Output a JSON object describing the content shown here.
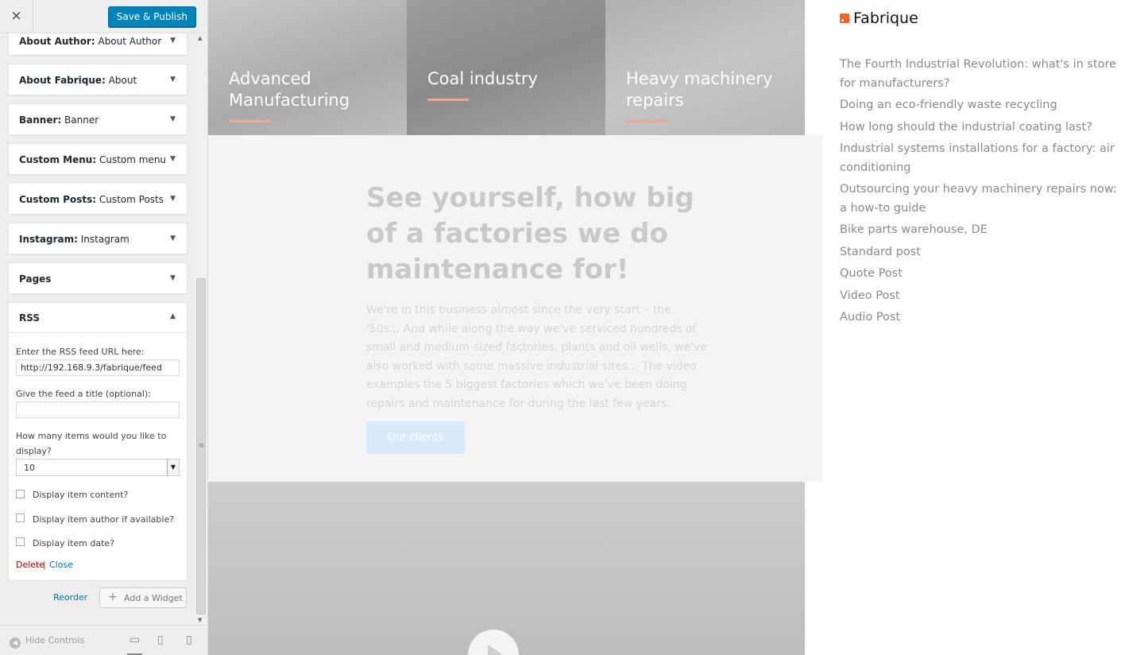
{
  "customizer": {
    "close_icon": "×",
    "save_label": "Save & Publish",
    "widgets": [
      {
        "type": "About Author:",
        "title": "About Author"
      },
      {
        "type": "About Fabrique:",
        "title": "About"
      },
      {
        "type": "Banner:",
        "title": "Banner"
      },
      {
        "type": "Custom Menu:",
        "title": "Custom menu"
      },
      {
        "type": "Custom Posts:",
        "title": "Custom Posts"
      },
      {
        "type": "Instagram:",
        "title": "Instagram"
      },
      {
        "type": "Pages",
        "title": ""
      }
    ],
    "rss_widget": {
      "title": "RSS",
      "url_label": "Enter the RSS feed URL here:",
      "url_value": "http://192.168.9.3/fabrique/feed",
      "title_label": "Give the feed a title (optional):",
      "title_value": "",
      "items_label": "How many items would you like to display?",
      "items_value": "10",
      "check_content": "Display item content?",
      "check_author": "Display item author if available?",
      "check_date": "Display item date?",
      "delete_label": "Delete",
      "separator": "|",
      "close_label": "Close"
    },
    "reorder_label": "Reorder",
    "add_widget_label": "Add a Widget",
    "hide_controls_label": "Hide Controls"
  },
  "preview": {
    "panels": [
      {
        "title": "Advanced Manufacturing"
      },
      {
        "title": "Coal industry"
      },
      {
        "title": "Heavy machinery repairs"
      }
    ],
    "heading": "See yourself, how big of a factories we do maintenance for!",
    "body": "We're in this business almost since the very start – the '50s... And while along the way we've serviced hundreds of small and medium-sized factories, plants and oil wells, we've also worked with some massive industrial sites... The video examples the 5 biggest factories which we've been doing repairs and maintenance for during the last few years.",
    "button_label": "Our clients",
    "rss_title": "Fabrique",
    "rss_items": [
      "The Fourth Industrial Revolution: what's in store for manufacturers?",
      "Doing an eco-friendly waste recycling",
      "How long should the industrial coating last?",
      "Industrial systems installations for a factory: air conditioning",
      "Outsourcing your heavy machinery repairs now: a how-to guide",
      "Bike parts warehouse, DE",
      "Standard post",
      "Quote Post",
      "Video Post",
      "Audio Post"
    ]
  },
  "colors": {
    "primary_button": "#0085ba",
    "delete_link": "#a00000",
    "link": "#0073aa",
    "accent_line": "#f0a890",
    "rss_icon": "#f26522"
  },
  "icons": {
    "close": "close-icon",
    "widget_toggle": "triangle-down-icon",
    "rss_toggle": "triangle-up-icon",
    "add": "plus-icon",
    "hide_controls": "arrow-left-circle-icon",
    "desktop": "desktop-icon",
    "tablet": "tablet-icon",
    "mobile": "mobile-icon",
    "play": "play-icon",
    "rss": "rss-feed-icon"
  }
}
